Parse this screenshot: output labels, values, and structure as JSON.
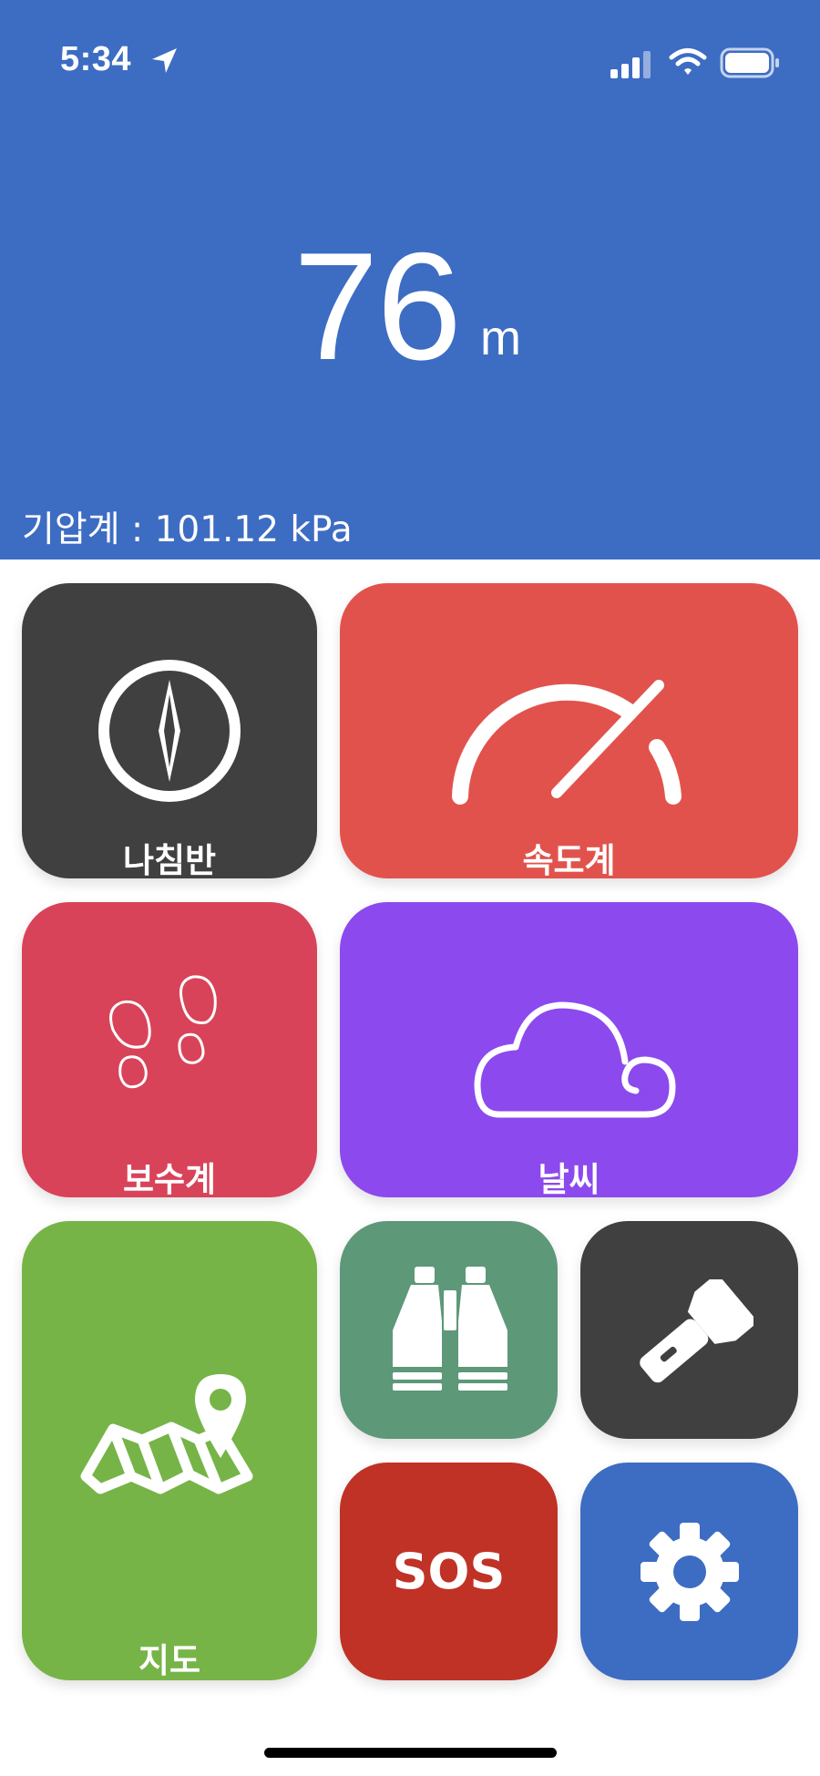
{
  "status_bar": {
    "time": "5:34",
    "icons": [
      "location-arrow-icon",
      "cellular-signal-icon",
      "wifi-icon",
      "battery-icon"
    ]
  },
  "altimeter": {
    "value": "76",
    "unit": "m",
    "pressure_text": "기압계 : 101.12 kPa"
  },
  "tiles": {
    "compass": {
      "label": "나침반",
      "icon": "compass-icon",
      "color": "#404040"
    },
    "speedometer": {
      "label": "속도계",
      "icon": "speedometer-icon",
      "color": "#e2524c"
    },
    "pedometer": {
      "label": "보수계",
      "icon": "footprints-icon",
      "color": "#d84359"
    },
    "weather": {
      "label": "날씨",
      "icon": "cloud-icon",
      "color": "#8b49ee"
    },
    "map": {
      "label": "지도",
      "icon": "map-pin-icon",
      "color": "#76b447"
    },
    "binoculars": {
      "icon": "binoculars-icon",
      "color": "#5d9879"
    },
    "flashlight": {
      "icon": "flashlight-icon",
      "color": "#404040"
    },
    "sos": {
      "label": "SOS",
      "color": "#c03225"
    },
    "settings": {
      "icon": "gear-icon",
      "color": "#3d6cc3"
    }
  },
  "colors": {
    "header_bg": "#3d6cc3",
    "page_bg": "#ffffff"
  }
}
